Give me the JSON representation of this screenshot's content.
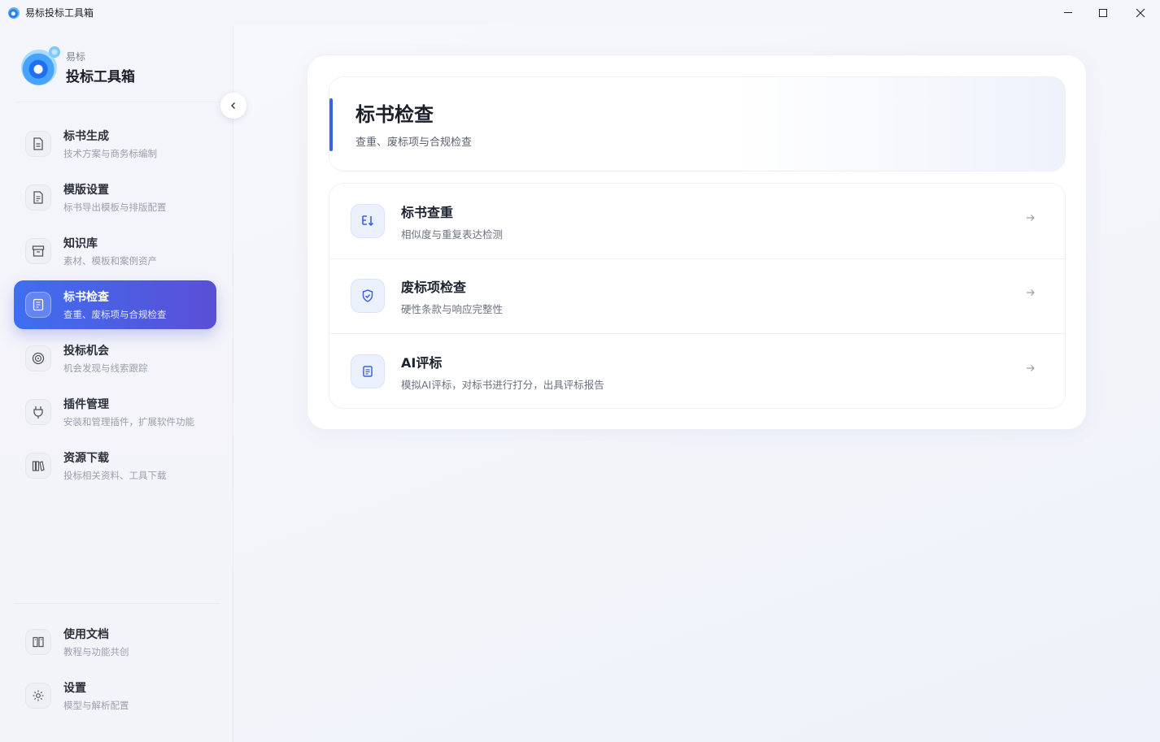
{
  "window": {
    "title": "易标投标工具箱"
  },
  "brand": {
    "subtitle": "易标",
    "name": "投标工具箱"
  },
  "sidebar": {
    "items": [
      {
        "label": "标书生成",
        "desc": "技术方案与商务标编制",
        "icon": "document-icon"
      },
      {
        "label": "模版设置",
        "desc": "标书导出模板与排版配置",
        "icon": "file-text-icon"
      },
      {
        "label": "知识库",
        "desc": "素材、模板和案例资产",
        "icon": "archive-icon"
      },
      {
        "label": "标书检查",
        "desc": "查重、废标项与合规检查",
        "icon": "clipboard-check-icon",
        "active": true
      },
      {
        "label": "投标机会",
        "desc": "机会发现与线索跟踪",
        "icon": "target-icon"
      },
      {
        "label": "插件管理",
        "desc": "安装和管理插件，扩展软件功能",
        "icon": "plug-icon"
      },
      {
        "label": "资源下载",
        "desc": "投标相关资料、工具下载",
        "icon": "library-icon"
      }
    ],
    "bottom_items": [
      {
        "label": "使用文档",
        "desc": "教程与功能共创",
        "icon": "book-icon"
      },
      {
        "label": "设置",
        "desc": "模型与解析配置",
        "icon": "gear-icon"
      }
    ]
  },
  "main": {
    "header": {
      "title": "标书检查",
      "subtitle": "查重、废标项与合规检查"
    },
    "rows": [
      {
        "label": "标书查重",
        "desc": "相似度与重复表达检测",
        "icon": "sort-duplicate-icon"
      },
      {
        "label": "废标项检查",
        "desc": "硬性条款与响应完整性",
        "icon": "shield-check-icon"
      },
      {
        "label": "AI评标",
        "desc": "模拟AI评标，对标书进行打分，出具评标报告",
        "icon": "report-icon"
      }
    ]
  },
  "colors": {
    "accent": "#3f6ef0",
    "accent_end": "#5a4fd6"
  }
}
